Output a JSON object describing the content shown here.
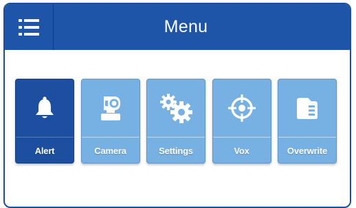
{
  "header": {
    "title": "Menu",
    "menu_icon": "list-icon"
  },
  "tiles": [
    {
      "label": "Alert",
      "icon": "bell-icon",
      "active": true
    },
    {
      "label": "Camera",
      "icon": "camera-icon",
      "active": false
    },
    {
      "label": "Settings",
      "icon": "gears-icon",
      "active": false
    },
    {
      "label": "Vox",
      "icon": "crosshair-icon",
      "active": false
    },
    {
      "label": "Overwrite",
      "icon": "sd-card-icon",
      "active": false
    }
  ],
  "colors": {
    "header": "#1e55a8",
    "tile_active": "#1c4f9f",
    "tile_inactive": "#77b0e2",
    "frame_border": "#1b4f9c"
  }
}
